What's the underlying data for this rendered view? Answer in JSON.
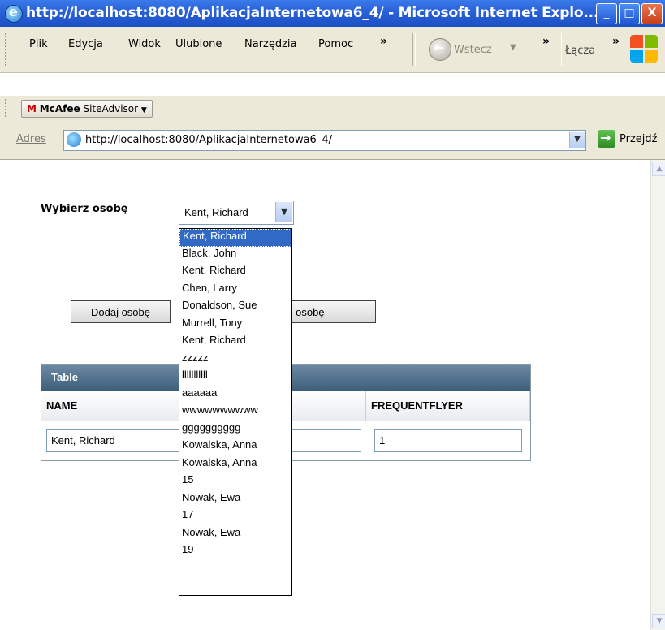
{
  "window": {
    "title": "http://localhost:8080/AplikacjaInternetowa6_4/ - Microsoft Internet Explo...",
    "minimize_label": "_",
    "maximize_label": "□",
    "close_label": "X"
  },
  "menu": {
    "items": [
      "Plik",
      "Edycja",
      "Widok",
      "Ulubione",
      "Narzędzia",
      "Pomoc"
    ],
    "back_label": "Wstecz",
    "links_label": "Łącza",
    "chevron": "»"
  },
  "mcafee": {
    "brand": "McAfee",
    "product": "SiteAdvisor"
  },
  "address": {
    "label": "Adres",
    "url": "http://localhost:8080/AplikacjaInternetowa6_4/",
    "go_label": "Przejdź"
  },
  "form": {
    "person_label": "Wybierz osobę",
    "selected_person": "Kent, Richard",
    "add_button": "Dodaj osobę",
    "edit_button_visible_text": "wuj osobę"
  },
  "dropdown_options": [
    "Kent, Richard",
    "Black, John",
    "Kent, Richard",
    "Chen, Larry",
    "Donaldson, Sue",
    "Murrell, Tony",
    "Kent, Richard",
    "zzzzz",
    "lllllllllll",
    "aaaaaa",
    "wwwwwwwwww",
    "gggggggggg",
    "Kowalska, Anna",
    "Kowalska, Anna",
    "15",
    "Nowak, Ewa",
    "17",
    "Nowak, Ewa",
    "19"
  ],
  "table": {
    "title": "Table",
    "columns": [
      "NAME",
      "FREQUENTFLYER"
    ],
    "rows": [
      {
        "name": "Kent, Richard",
        "frequentflyer": "1"
      }
    ]
  },
  "colors": {
    "titlebar": "#2a62d8",
    "table_header": "#4a6a86",
    "selection": "#316ac5"
  }
}
